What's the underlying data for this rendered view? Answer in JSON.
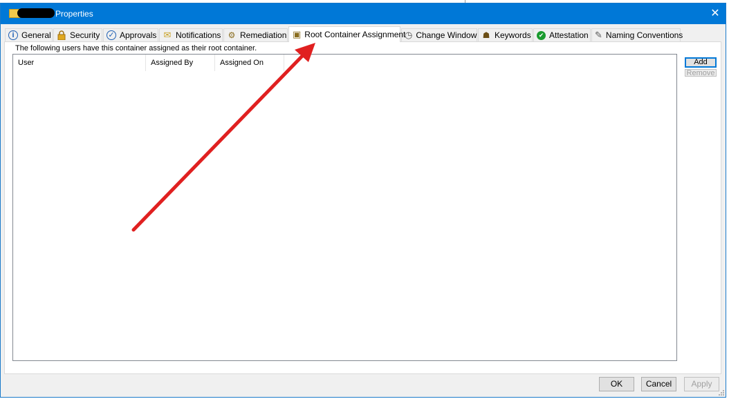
{
  "window": {
    "title": "Properties",
    "close_glyph": "✕"
  },
  "tabs": [
    {
      "label": "General",
      "icon": "info-icon",
      "glyph": "i",
      "color": "#1e5fb4"
    },
    {
      "label": "Security",
      "icon": "lock-icon",
      "glyph": "🔒",
      "color": "#d4a017"
    },
    {
      "label": "Approvals",
      "icon": "checkmark-circle-icon",
      "glyph": "✓",
      "color": "#1e5fb4"
    },
    {
      "label": "Notifications",
      "icon": "envelope-icon",
      "glyph": "✉",
      "color": "#c9a227"
    },
    {
      "label": "Remediation",
      "icon": "document-gear-icon",
      "glyph": "⚙",
      "color": "#8a6d1e"
    },
    {
      "label": "Root Container Assignment",
      "icon": "container-icon",
      "glyph": "▣",
      "color": "#8a6d1e"
    },
    {
      "label": "Change Window",
      "icon": "clock-icon",
      "glyph": "◷",
      "color": "#555555"
    },
    {
      "label": "Keywords",
      "icon": "user-keywords-icon",
      "glyph": "☗",
      "color": "#6b4e16"
    },
    {
      "label": "Attestation",
      "icon": "green-check-icon",
      "glyph": "✔",
      "color": "#1a9b2f"
    },
    {
      "label": "Naming Conventions",
      "icon": "pen-icon",
      "glyph": "✎",
      "color": "#555555"
    }
  ],
  "active_tab": "Root Container Assignment",
  "panel": {
    "description": "The following users have this container assigned as their root container.",
    "columns": [
      "User",
      "Assigned By",
      "Assigned On"
    ],
    "add_label": "Add",
    "remove_label": "Remove"
  },
  "footer": {
    "ok_label": "OK",
    "cancel_label": "Cancel",
    "apply_label": "Apply"
  },
  "colors": {
    "titlebar": "#0078d7",
    "arrow": "#e02020"
  }
}
